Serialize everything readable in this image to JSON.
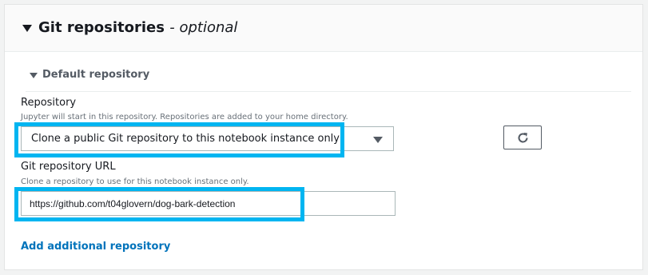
{
  "section": {
    "title": "Git repositories",
    "title_suffix": "- optional"
  },
  "default_repo": {
    "title": "Default repository"
  },
  "repository": {
    "label": "Repository",
    "description": "Jupyter will start in this repository. Repositories are added to your home directory.",
    "selected_value": "Clone a public Git repository to this notebook instance only"
  },
  "git_url": {
    "label": "Git repository URL",
    "description": "Clone a repository to use for this notebook instance only.",
    "value": "https://github.com/t04glovern/dog-bark-detection"
  },
  "actions": {
    "add_repository": "Add additional repository"
  },
  "colors": {
    "highlight": "#00b5f1",
    "link": "#0073bb"
  },
  "icons": {
    "refresh": "refresh-icon",
    "dropdown": "caret-down-icon"
  }
}
